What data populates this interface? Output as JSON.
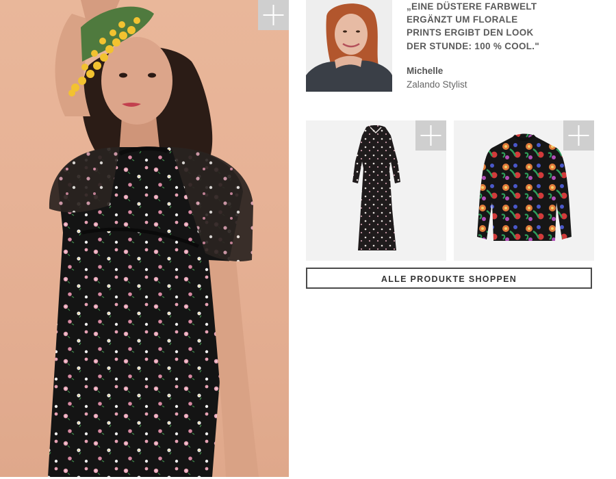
{
  "stylist": {
    "quote_lines": [
      "„EINE DÜSTERE FARBWELT",
      "ERGÄNZT UM FLORALE",
      "PRINTS ERGIBT DEN LOOK",
      "DER STUNDE: 100 % COOL.\""
    ],
    "name": "Michelle",
    "role": "Zalando Stylist"
  },
  "shop_button": {
    "label": "ALLE PRODUKTE SHOPPEN"
  },
  "icons": {
    "add": "plus-icon"
  },
  "colors": {
    "hero_background": "#e9b79a",
    "add_button": "#cfcfcf",
    "product_background": "#f2f2f2",
    "button_border": "#4a4a4a",
    "text": "#5a5a5a"
  }
}
